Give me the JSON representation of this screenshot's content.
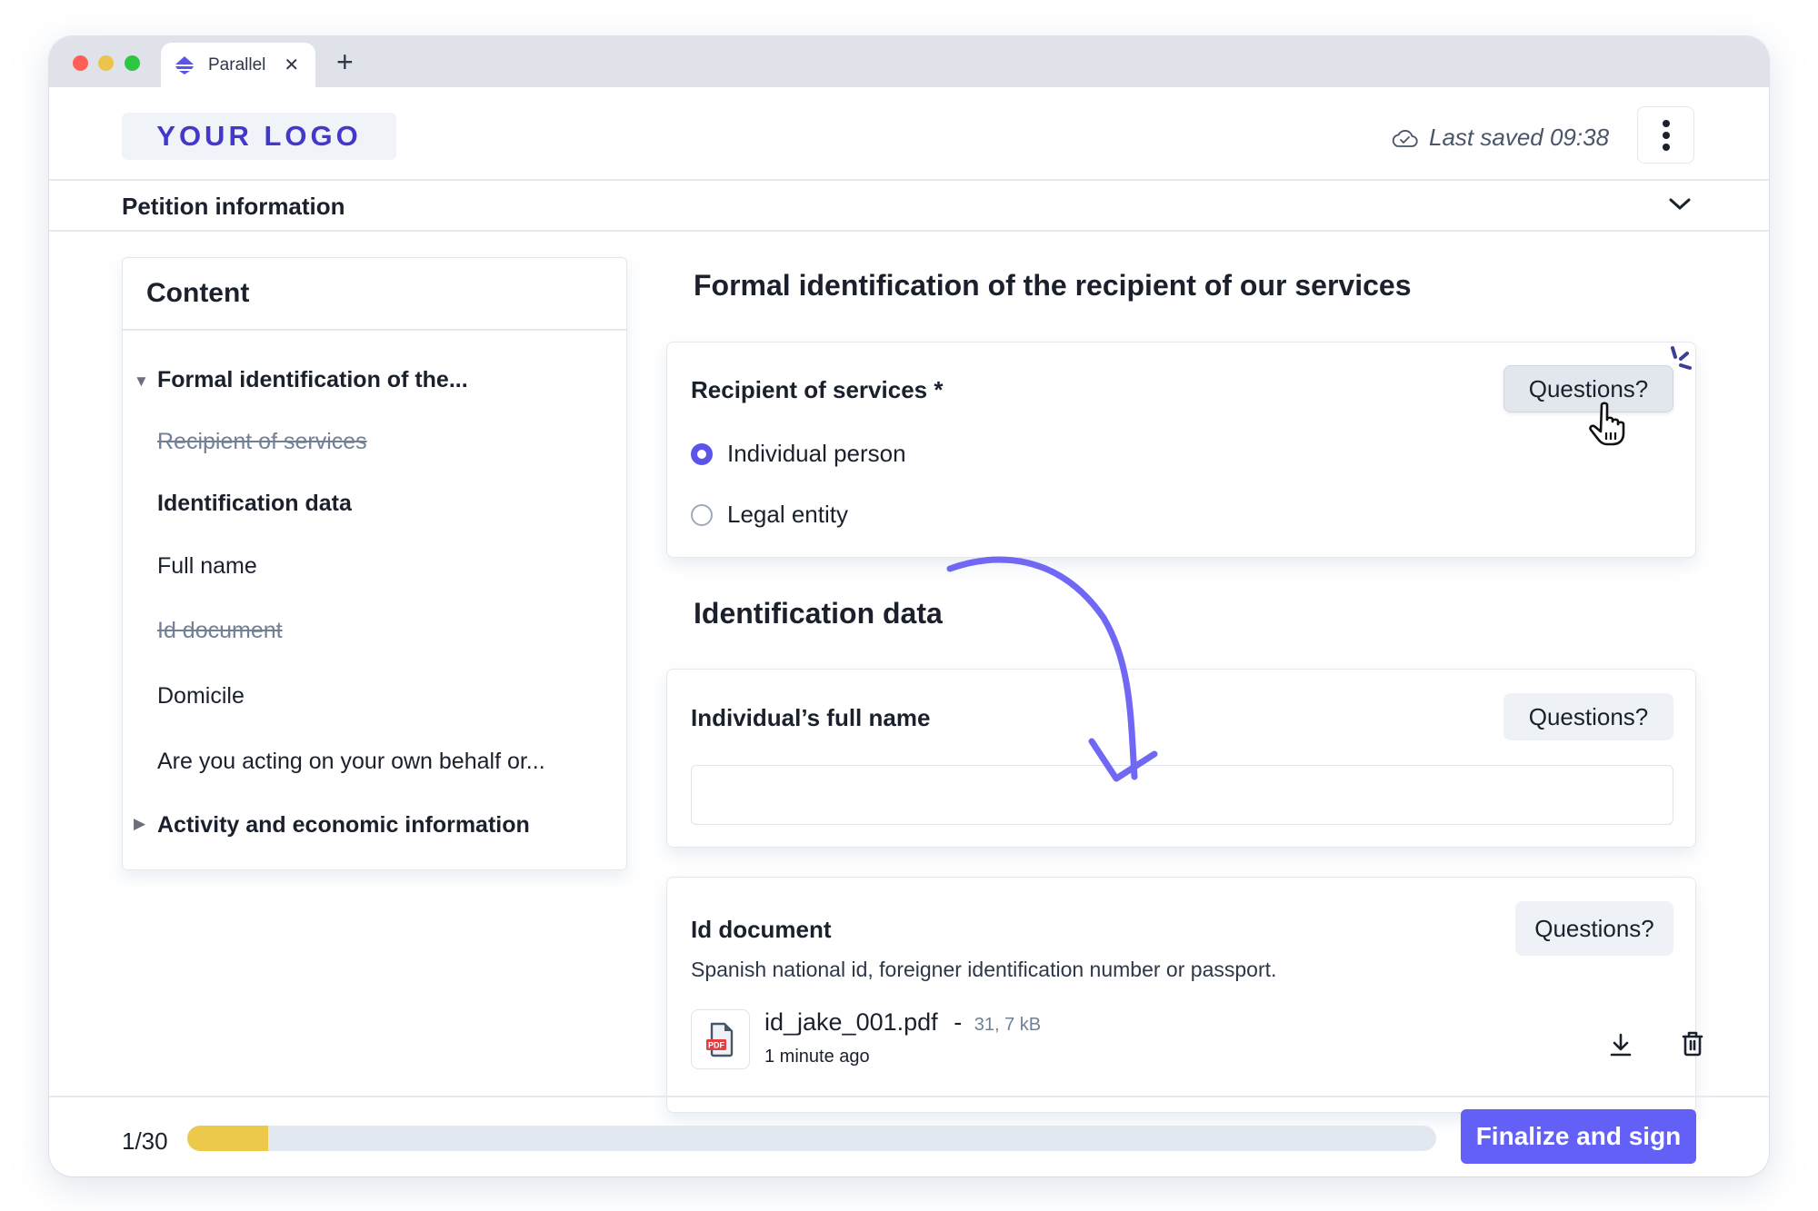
{
  "browser": {
    "tab_title": "Parallel",
    "tab_icon": "parallel-logo-icon",
    "close_icon": "close-icon",
    "new_tab_icon": "plus-icon",
    "traffic_lights": [
      "#ff5f57",
      "#ebc44d",
      "#29c840"
    ]
  },
  "header": {
    "logo_text": "YOUR LOGO",
    "save_status": "Last saved 09:38",
    "save_icon": "cloud-check-icon",
    "menu_icon": "kebab-menu-icon"
  },
  "petition_bar": {
    "title": "Petition information",
    "toggle_icon": "chevron-down-icon"
  },
  "sidebar": {
    "title": "Content",
    "items": [
      {
        "label": "Formal identification of the...",
        "type": "section",
        "expanded": true
      },
      {
        "label": "Recipient of services",
        "type": "field",
        "completed": true
      },
      {
        "label": "Identification data",
        "type": "heading"
      },
      {
        "label": "Full name",
        "type": "field",
        "completed": false
      },
      {
        "label": "Id document",
        "type": "field",
        "completed": true
      },
      {
        "label": "Domicile",
        "type": "field",
        "completed": false
      },
      {
        "label": "Are you acting on your own behalf or...",
        "type": "field",
        "completed": false
      },
      {
        "label": "Activity and economic information",
        "type": "section",
        "expanded": false
      }
    ]
  },
  "main": {
    "section_title": "Formal identification of the recipient of our services",
    "recipient_card": {
      "label": "Recipient of services *",
      "questions_label": "Questions?",
      "options": [
        {
          "label": "Individual person",
          "selected": true
        },
        {
          "label": "Legal entity",
          "selected": false
        }
      ]
    },
    "identification_title": "Identification data",
    "full_name_card": {
      "label": "Individual’s full name",
      "questions_label": "Questions?",
      "value": "",
      "placeholder": ""
    },
    "id_document_card": {
      "label": "Id document",
      "questions_label": "Questions?",
      "help_text": "Spanish national id, foreigner identification number or passport.",
      "file": {
        "name": "id_jake_001.pdf",
        "separator": "-",
        "size": "31, 7 kB",
        "uploaded": "1 minute ago",
        "type_badge": "PDF"
      },
      "download_icon": "download-icon",
      "delete_icon": "trash-icon"
    }
  },
  "footer": {
    "progress_text": "1/30",
    "progress_fraction": 0.065,
    "finalize_label": "Finalize and sign"
  },
  "colors": {
    "accent": "#6360f7",
    "logo": "#4338ca",
    "progress_fill": "#ecc94b",
    "progress_track": "#e2e8f0",
    "annotation_arrow": "#7068f5"
  }
}
